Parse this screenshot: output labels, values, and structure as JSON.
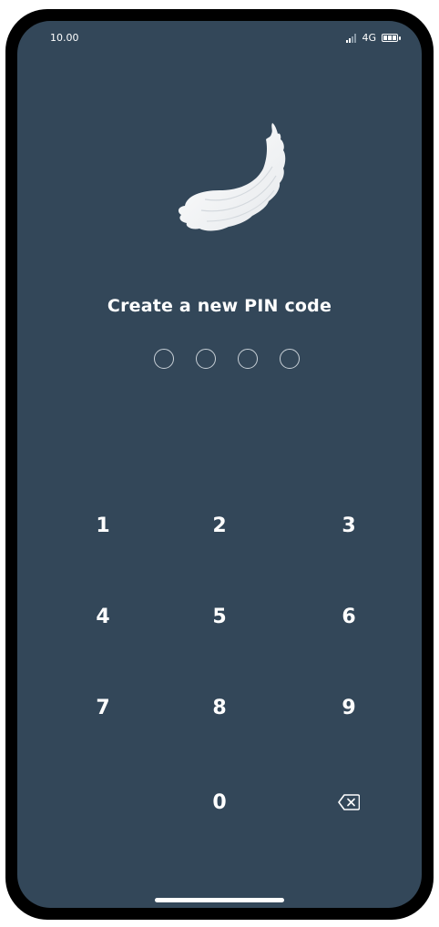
{
  "status_bar": {
    "time": "10.00",
    "network": "4G",
    "icons": [
      "signal-icon",
      "battery-icon"
    ]
  },
  "logo": {
    "icon": "feather-brush-logo-icon"
  },
  "title": "Create a new PIN code",
  "pin": {
    "length": 4,
    "entered": 0
  },
  "keypad": {
    "keys": [
      "1",
      "2",
      "3",
      "4",
      "5",
      "6",
      "7",
      "8",
      "9",
      "0"
    ],
    "backspace_icon": "backspace-icon"
  },
  "colors": {
    "background": "#334759",
    "text": "#ffffff",
    "dot_outline": "#c9d1d8"
  }
}
